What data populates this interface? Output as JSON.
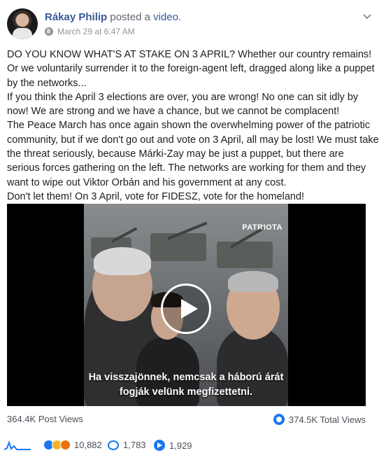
{
  "post": {
    "author": "Rákay Philip",
    "action": "posted a",
    "object": "video.",
    "timestamp": "March 29 at 6:47 AM",
    "paragraphs": [
      "DO YOU KNOW WHAT'S AT STAKE ON 3 APRIL? Whether our country remains! Or we voluntarily surrender it to the foreign-agent left, dragged along like a puppet by the networks...",
      "If you think the April 3 elections are over, you are wrong! No one can sit idly by now! We are strong and we have a chance, but we cannot be complacent!",
      "The Peace March has once again shown the overwhelming power of the patriotic community, but if we don't go out and vote on 3 April, all may be lost! We must take the threat seriously, because Márki-Zay may be just a puppet, but there are serious forces gathering on the left.  The networks are working for them and they want to wipe out Viktor Orbán and his government at any cost.",
      "Don't let them! On 3 April, vote for FIDESZ, vote for the homeland!"
    ]
  },
  "video": {
    "brand": "PATRIOTA",
    "caption": "Ha visszajönnek, nemcsak a háború árát fogják velünk megfizettetni."
  },
  "stats": {
    "post_views": "364.4K Post Views",
    "total_views": "374.5K Total Views"
  },
  "footer": {
    "reactions": "10,882",
    "comments": "1,783",
    "shares": "1,929"
  },
  "colors": {
    "link": "#385898",
    "accent": "#1877f2"
  },
  "icons": [
    "globe-icon",
    "chevron-down-icon",
    "play-icon",
    "views-icon",
    "sparkline-icon",
    "like-icon",
    "haha-icon",
    "angry-icon",
    "comment-icon",
    "share-icon"
  ]
}
